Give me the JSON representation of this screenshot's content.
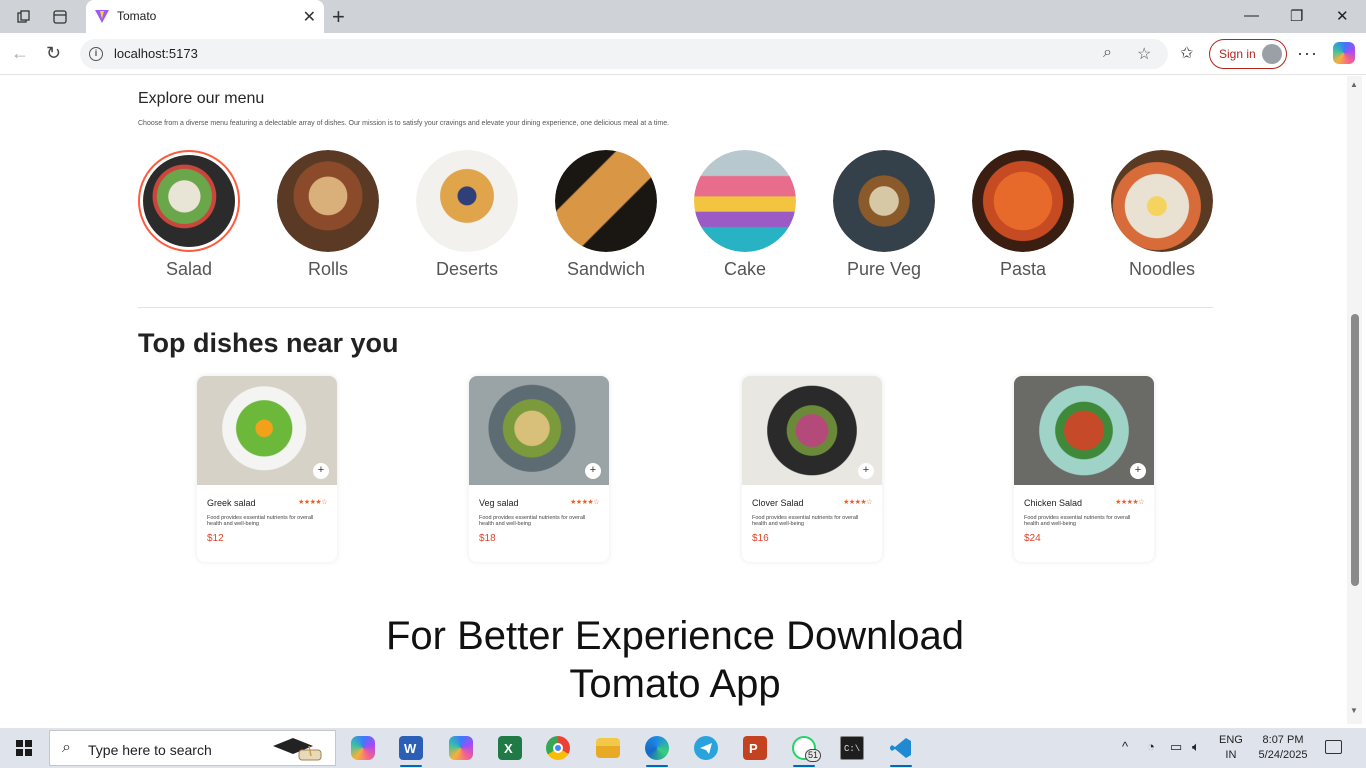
{
  "browser": {
    "tab_title": "Tomato",
    "url": "localhost:5173",
    "sign_in_label": "Sign in"
  },
  "page": {
    "menu_title": "Explore our menu",
    "menu_description": "Choose from a diverse menu featuring a delectable array of dishes. Our mission is to satisfy your cravings and elevate your dining experience, one delicious meal at a time.",
    "categories": [
      {
        "label": "Salad",
        "active": true
      },
      {
        "label": "Rolls",
        "active": false
      },
      {
        "label": "Deserts",
        "active": false
      },
      {
        "label": "Sandwich",
        "active": false
      },
      {
        "label": "Cake",
        "active": false
      },
      {
        "label": "Pure Veg",
        "active": false
      },
      {
        "label": "Pasta",
        "active": false
      },
      {
        "label": "Noodles",
        "active": false
      }
    ],
    "top_dishes_title": "Top dishes near you",
    "dishes": [
      {
        "name": "Greek salad",
        "description": "Food provides essential nutrients for overall health and well-being",
        "price": "$12",
        "rating": 4
      },
      {
        "name": "Veg salad",
        "description": "Food provides essential nutrients for overall health and well-being",
        "price": "$18",
        "rating": 4
      },
      {
        "name": "Clover Salad",
        "description": "Food provides essential nutrients for overall health and well-being",
        "price": "$16",
        "rating": 4
      },
      {
        "name": "Chicken Salad",
        "description": "Food provides essential nutrients for overall health and well-being",
        "price": "$24",
        "rating": 4
      }
    ],
    "app_download_line1": "For Better Experience Download",
    "app_download_line2": "Tomato App"
  },
  "taskbar": {
    "search_placeholder": "Type here to search",
    "language": "ENG",
    "region": "IN",
    "time": "8:07 PM",
    "date": "5/24/2025",
    "whatsapp_badge": "51",
    "apps": [
      "copilot-icon",
      "word-icon",
      "m365-icon",
      "excel-icon",
      "chrome-icon",
      "file-explorer-icon",
      "edge-icon",
      "telegram-icon",
      "powerpoint-icon",
      "whatsapp-icon",
      "terminal-icon",
      "vscode-icon"
    ]
  },
  "colors": {
    "accent": "#ff5a3c",
    "price": "#e0452b",
    "signin": "#b3261e"
  }
}
